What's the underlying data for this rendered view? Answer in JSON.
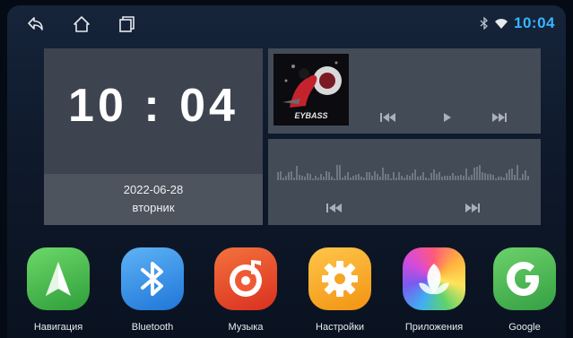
{
  "status_bar": {
    "time": "10:04",
    "icons": [
      "back-icon",
      "home-icon",
      "recent-apps-icon",
      "bluetooth-icon",
      "wifi-icon"
    ]
  },
  "clock_widget": {
    "time": "10 : 04",
    "date": "2022-06-28",
    "weekday": "вторник"
  },
  "music_widget": {
    "album_text": "EYBASS",
    "controls": [
      "previous-icon",
      "play-icon",
      "next-icon"
    ]
  },
  "radio_widget": {
    "controls": [
      "previous-icon",
      "next-icon"
    ]
  },
  "apps": [
    {
      "label": "Навигация",
      "icon": "navigation-icon",
      "color": "#4cc247"
    },
    {
      "label": "Bluetooth",
      "icon": "bluetooth-icon",
      "color": "#2f8fe6"
    },
    {
      "label": "Музыка",
      "icon": "music-icon",
      "color": "#e9462b"
    },
    {
      "label": "Настройки",
      "icon": "settings-icon",
      "color": "#f7a81e"
    },
    {
      "label": "Приложения",
      "icon": "apps-icon",
      "color": "#b05ad8"
    },
    {
      "label": "Google",
      "icon": "google-icon",
      "color": "#44b34a"
    }
  ],
  "colors": {
    "accent": "#37b5ff",
    "panel": "#434b57"
  }
}
